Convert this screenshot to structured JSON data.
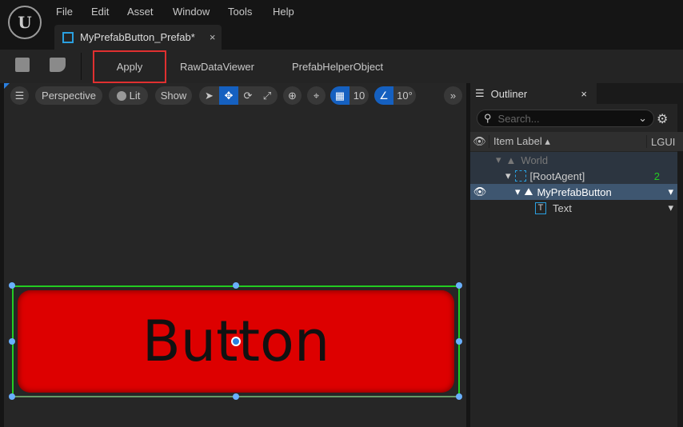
{
  "menu": [
    "File",
    "Edit",
    "Asset",
    "Window",
    "Tools",
    "Help"
  ],
  "tab": {
    "title": "MyPrefabButton_Prefab*",
    "close": "×"
  },
  "toolbar": {
    "apply": "Apply",
    "raw": "RawDataViewer",
    "helper": "PrefabHelperObject"
  },
  "viewport": {
    "perspective": "Perspective",
    "lit": "Lit",
    "show": "Show",
    "grid_size": "10",
    "angle": "10°",
    "widget_text": "Button",
    "widget_color": "#dd0000",
    "selection_color": "#22cc22"
  },
  "outliner": {
    "title": "Outliner",
    "close": "×",
    "search_placeholder": "Search...",
    "col_label": "Item Label",
    "col_lgui": "LGUI",
    "rows": [
      {
        "label": "World"
      },
      {
        "label": "[RootAgent]",
        "badge": "2"
      },
      {
        "label": "MyPrefabButton"
      },
      {
        "label": "Text"
      }
    ]
  }
}
